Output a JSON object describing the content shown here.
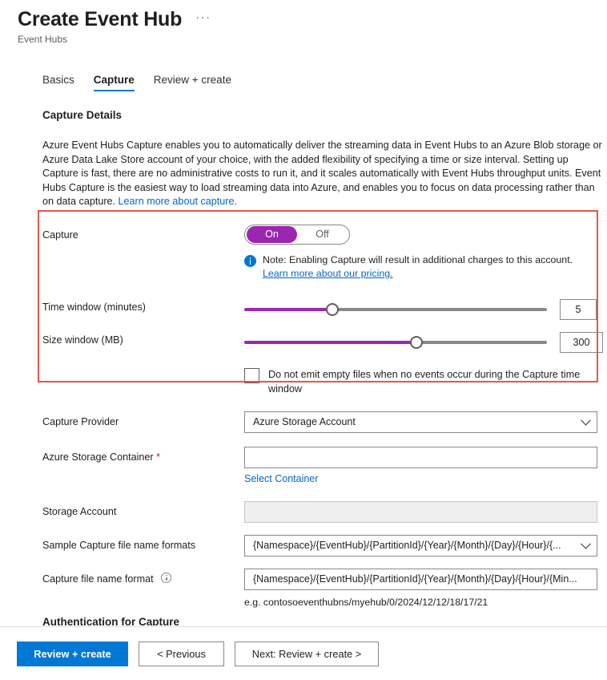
{
  "header": {
    "title": "Create Event Hub",
    "subtitle": "Event Hubs",
    "more_menu": "···"
  },
  "tabs": [
    {
      "label": "Basics",
      "active": false
    },
    {
      "label": "Capture",
      "active": true
    },
    {
      "label": "Review + create",
      "active": false
    }
  ],
  "main": {
    "section_heading": "Capture Details",
    "description": "Azure Event Hubs Capture enables you to automatically deliver the streaming data in Event Hubs to an Azure Blob storage or Azure Data Lake Store account of your choice, with the added flexibility of specifying a time or size interval. Setting up Capture is fast, there are no administrative costs to run it, and it scales automatically with Event Hubs throughput units. Event Hubs Capture is the easiest way to load streaming data into Azure, and enables you to focus on data processing rather than on data capture.",
    "description_link": "Learn more about capture.",
    "clipped_section_heading": "Authentication for Capture"
  },
  "capture": {
    "label": "Capture",
    "toggle_on": "On",
    "toggle_off": "Off",
    "toggle_value": "On",
    "note": "Note: Enabling Capture will result in additional charges to this account.",
    "note_link": "Learn more about our pricing."
  },
  "time_window": {
    "label": "Time window (minutes)",
    "value": "5",
    "percent": 29
  },
  "size_window": {
    "label": "Size window (MB)",
    "value": "300",
    "percent": 57
  },
  "empty_files": {
    "label": "Do not emit empty files when no events occur during the Capture time window",
    "checked": false
  },
  "capture_provider": {
    "label": "Capture Provider",
    "value": "Azure Storage Account"
  },
  "storage_container": {
    "label": "Azure Storage Container",
    "required_mark": "*",
    "value": "",
    "helper_link": "Select Container"
  },
  "storage_account": {
    "label": "Storage Account",
    "value": ""
  },
  "sample_format": {
    "label": "Sample Capture file name formats",
    "value": "{Namespace}/{EventHub}/{PartitionId}/{Year}/{Month}/{Day}/{Hour}/{..."
  },
  "capture_format": {
    "label": "Capture file name format",
    "value": "{Namespace}/{EventHub}/{PartitionId}/{Year}/{Month}/{Day}/{Hour}/{Min...",
    "example": "e.g. contosoeventhubns/myehub/0/2024/12/12/18/17/21"
  },
  "footer": {
    "review_create": "Review + create",
    "previous": "< Previous",
    "next": "Next: Review + create >"
  },
  "colors": {
    "accent_blue": "#0078d4",
    "toggle_purple": "#9b27b0",
    "highlight_red": "#e8544a",
    "link_blue": "#0066cc",
    "required_red": "#a4262c"
  }
}
